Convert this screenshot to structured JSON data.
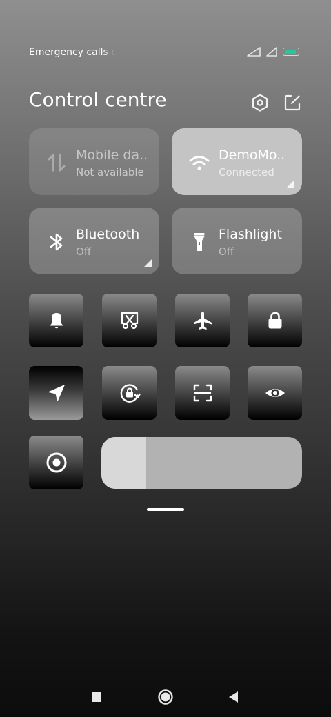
{
  "status_bar": {
    "carrier_text": "Emergency calls only",
    "battery_color": "#26c6a0",
    "battery_level": 0.9,
    "icons": [
      "signal-icon",
      "signal-icon",
      "battery-icon"
    ]
  },
  "header": {
    "title": "Control centre",
    "settings_icon": "settings-hexagon-icon",
    "edit_icon": "edit-icon"
  },
  "big_tiles": [
    {
      "id": "mobile-data",
      "name": "Mobile da..",
      "status": "Not available",
      "icon": "mobile-data-icon",
      "state": "unavailable"
    },
    {
      "id": "wifi",
      "name": "DemoMo..",
      "status": "Connected",
      "icon": "wifi-icon",
      "state": "on"
    },
    {
      "id": "bluetooth",
      "name": "Bluetooth",
      "status": "Off",
      "icon": "bluetooth-icon",
      "state": "off"
    },
    {
      "id": "flashlight",
      "name": "Flashlight",
      "status": "Off",
      "icon": "flashlight-icon",
      "state": "off"
    }
  ],
  "toggles": [
    {
      "id": "sound",
      "icon": "bell-icon",
      "active": false
    },
    {
      "id": "screenshot",
      "icon": "screenshot-scissors-icon",
      "active": false
    },
    {
      "id": "airplane-mode",
      "icon": "airplane-icon",
      "active": false
    },
    {
      "id": "lock-screen",
      "icon": "lock-icon",
      "active": false
    },
    {
      "id": "location",
      "icon": "location-arrow-icon",
      "active": true
    },
    {
      "id": "auto-rotate",
      "icon": "rotation-lock-icon",
      "active": false
    },
    {
      "id": "scanner",
      "icon": "scan-icon",
      "active": false
    },
    {
      "id": "reading-mode",
      "icon": "eye-icon",
      "active": false
    },
    {
      "id": "screen-recorder",
      "icon": "record-icon",
      "active": false
    }
  ],
  "brightness": {
    "level": 0.22,
    "icon": "brightness-slider"
  },
  "navigation": {
    "icons": [
      "recents-square-icon",
      "home-circle-icon",
      "back-triangle-icon"
    ]
  }
}
